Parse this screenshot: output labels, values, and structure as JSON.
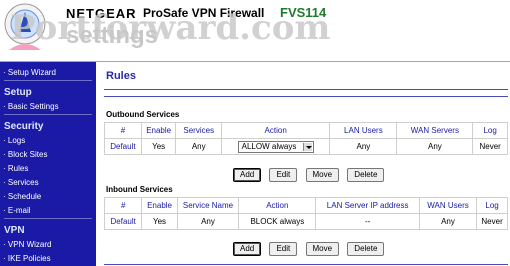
{
  "header": {
    "brand": "NETGEAR",
    "product": "ProSafe VPN Firewall",
    "model": "FVS114",
    "watermark_text": "Portforward.com",
    "watermark_subtext": "settings"
  },
  "sidebar": {
    "sections": [
      {
        "title": "",
        "items": [
          "Setup Wizard"
        ]
      },
      {
        "title": "Setup",
        "items": [
          "Basic Settings"
        ]
      },
      {
        "title": "Security",
        "items": [
          "Logs",
          "Block Sites",
          "Rules",
          "Services",
          "Schedule",
          "E-mail"
        ]
      },
      {
        "title": "VPN",
        "items": [
          "VPN Wizard",
          "IKE Policies"
        ]
      }
    ]
  },
  "main": {
    "title": "Rules",
    "outbound": {
      "label": "Outbound Services",
      "headers": [
        "#",
        "Enable",
        "Services",
        "Action",
        "LAN Users",
        "WAN Servers",
        "Log"
      ],
      "rows": [
        {
          "num": "Default",
          "enable": "Yes",
          "service": "Any",
          "action": "ALLOW always",
          "lan_users": "Any",
          "wan_servers": "Any",
          "log": "Never"
        }
      ]
    },
    "inbound": {
      "label": "Inbound Services",
      "headers": [
        "#",
        "Enable",
        "Service Name",
        "Action",
        "LAN Server IP address",
        "WAN Users",
        "Log"
      ],
      "rows": [
        {
          "num": "Default",
          "enable": "Yes",
          "service": "Any",
          "action": "BLOCK always",
          "lan_ip": "--",
          "wan_users": "Any",
          "log": "Never"
        }
      ]
    },
    "buttons": {
      "add": "Add",
      "edit": "Edit",
      "move": "Move",
      "delete": "Delete"
    }
  },
  "colors": {
    "sidebar_bg": "#1a1aa6",
    "accent": "#1a1aa6",
    "model": "#1f7a2e"
  }
}
